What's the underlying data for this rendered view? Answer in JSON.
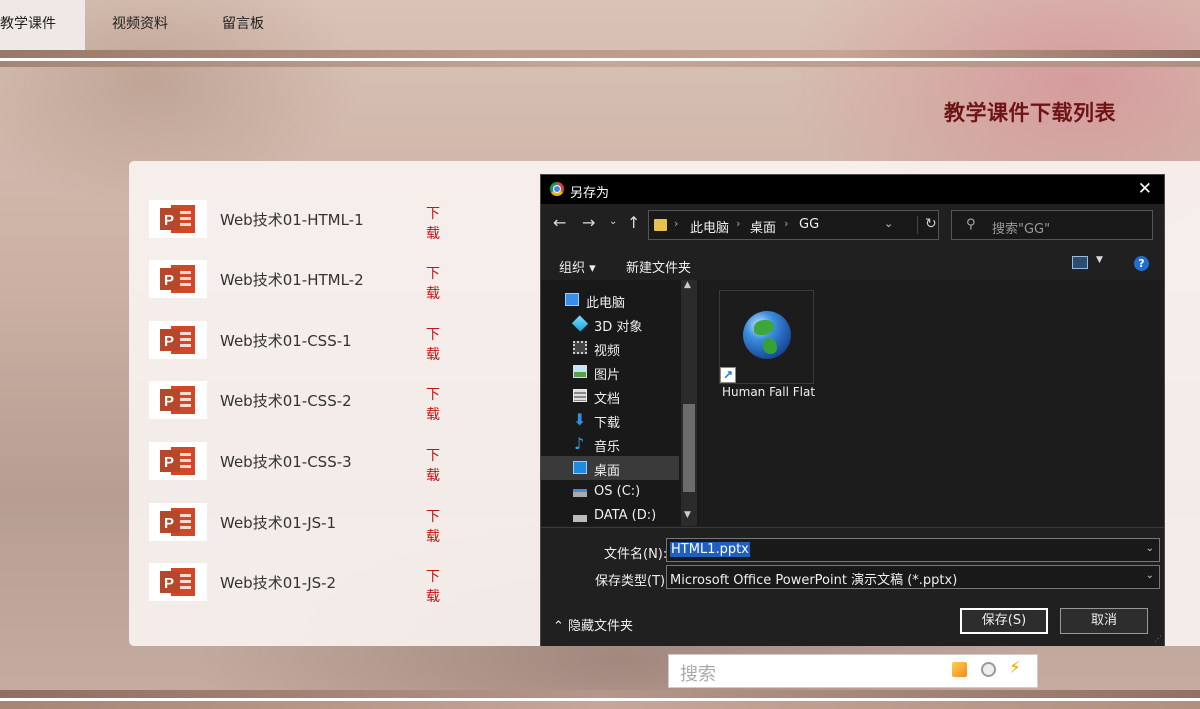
{
  "nav": {
    "items": [
      "教学课件",
      "视频资料",
      "留言板"
    ]
  },
  "page_title": "教学课件下载列表",
  "files": [
    {
      "name": "Web技术01-HTML-1",
      "action": "下载"
    },
    {
      "name": "Web技术01-HTML-2",
      "action": "下载"
    },
    {
      "name": "Web技术01-CSS-1",
      "action": "下载"
    },
    {
      "name": "Web技术01-CSS-2",
      "action": "下载"
    },
    {
      "name": "Web技术01-CSS-3",
      "action": "下载"
    },
    {
      "name": "Web技术01-JS-1",
      "action": "下载"
    },
    {
      "name": "Web技术01-JS-2",
      "action": "下载"
    }
  ],
  "dialog": {
    "title": "另存为",
    "close": "✕",
    "address": {
      "crumbs": [
        "此电脑",
        "桌面",
        "GG"
      ]
    },
    "search_placeholder": "搜索\"GG\"",
    "toolbar": {
      "organize": "组织 ▾",
      "new_folder": "新建文件夹",
      "help": "?"
    },
    "tree": [
      {
        "label": "此电脑",
        "icon": "pc-icon"
      },
      {
        "label": "3D 对象",
        "icon": "3d-objects-icon"
      },
      {
        "label": "视频",
        "icon": "video-icon"
      },
      {
        "label": "图片",
        "icon": "pictures-icon"
      },
      {
        "label": "文档",
        "icon": "documents-icon"
      },
      {
        "label": "下载",
        "icon": "download-icon"
      },
      {
        "label": "音乐",
        "icon": "music-icon"
      },
      {
        "label": "桌面",
        "icon": "desktop-icon",
        "selected": true
      },
      {
        "label": "OS (C:)",
        "icon": "drive-c-icon"
      },
      {
        "label": "DATA (D:)",
        "icon": "drive-d-icon"
      }
    ],
    "files": [
      {
        "name": "Human Fall Flat",
        "type": "shortcut"
      }
    ],
    "filename_label": "文件名(N):",
    "filename_value": "HTML1.pptx",
    "filetype_label": "保存类型(T):",
    "filetype_value": "Microsoft Office PowerPoint 演示文稿 (*.pptx)",
    "hide_folders": "隐藏文件夹",
    "save_button": "保存(S)",
    "cancel_button": "取消"
  },
  "web_search": {
    "placeholder": "搜索"
  },
  "colors": {
    "accent_title": "#6e1414",
    "download_link": "#c21414",
    "ppt_red": "#d24726",
    "dialog_bg": "#202020",
    "selection": "#1f5fbf"
  }
}
